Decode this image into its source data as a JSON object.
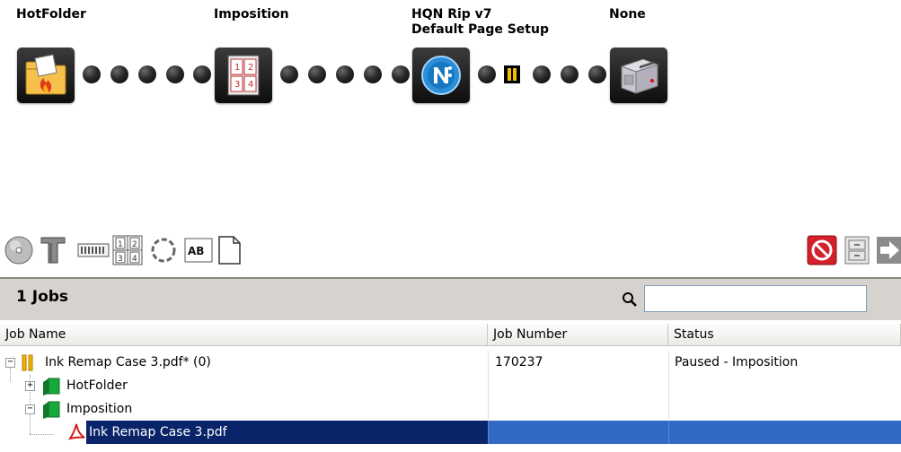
{
  "workflow": {
    "nodes": [
      {
        "label": "HotFolder",
        "icon": "hotfolder-icon"
      },
      {
        "label": "Imposition",
        "icon": "imposition-icon"
      },
      {
        "label": "HQN Rip v7\nDefault Page Setup",
        "icon": "hqn-rip-icon"
      },
      {
        "label": "None",
        "icon": "output-device-icon"
      }
    ]
  },
  "toolbar": {
    "icons": [
      "disc-icon",
      "column-icon",
      "film-strip-icon",
      "imposition-grid-icon",
      "refresh-icon",
      "ab-text-icon",
      "page-icon"
    ],
    "right_icons": [
      "stop-icon",
      "cabinet-icon",
      "arrow-right-icon"
    ]
  },
  "jobs_header": {
    "count_label": "1 Jobs",
    "search_placeholder": ""
  },
  "table": {
    "columns": [
      "Job Name",
      "Job Number",
      "Status"
    ],
    "rows": [
      {
        "name": "Ink Remap Case 3.pdf* (0)",
        "job_number": "170237",
        "status": "Paused - Imposition",
        "expander": "−",
        "icon": "paused-icon"
      },
      {
        "name": "HotFolder",
        "job_number": "",
        "status": "",
        "expander": "+",
        "icon": "green-block-icon"
      },
      {
        "name": "Imposition",
        "job_number": "",
        "status": "",
        "expander": "−",
        "icon": "green-block-icon"
      },
      {
        "name": "Ink Remap Case 3.pdf",
        "job_number": "",
        "status": "",
        "icon": "pdf-icon",
        "selected": true
      }
    ]
  },
  "colors": {
    "selection": "#316ac5",
    "selection_dark": "#0a246a",
    "node_bg": "#1a1a1a",
    "pause": "#f0c000",
    "green": "#19a83c",
    "stop_red": "#d4202a"
  }
}
